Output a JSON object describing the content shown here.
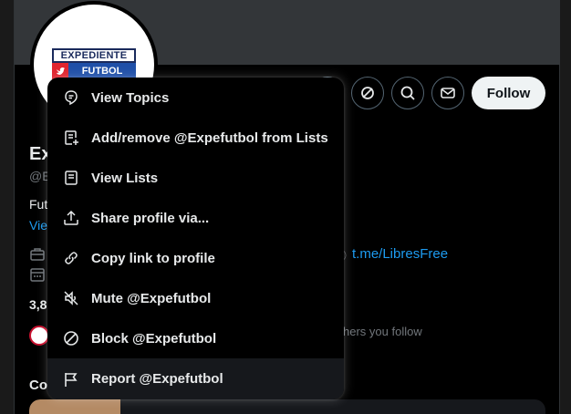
{
  "profile": {
    "logo_line1": "EXPEDIENTE",
    "logo_line2": "FUTBOL",
    "name_partial": "Ex",
    "handle_partial": "@E",
    "bio_partial": "Fut",
    "view_partial": "Vie",
    "link_text": "t.me/LibresFree",
    "stat_partial": "3,8",
    "followers_partial_text": "hers you follow",
    "section_partial": "Co",
    "follow_label": "Follow"
  },
  "actions": [
    {
      "icon": "unknown-partial-icon"
    },
    {
      "icon": "grok-icon"
    },
    {
      "icon": "search-icon"
    },
    {
      "icon": "message-icon"
    }
  ],
  "menu": {
    "items": [
      {
        "label": "View Topics",
        "icon": "topics-icon"
      },
      {
        "label": "Add/remove @Expefutbol from Lists",
        "icon": "list-add-icon"
      },
      {
        "label": "View Lists",
        "icon": "lists-icon"
      },
      {
        "label": "Share profile via...",
        "icon": "share-icon"
      },
      {
        "label": "Copy link to profile",
        "icon": "link-icon"
      },
      {
        "label": "Mute @Expefutbol",
        "icon": "mute-icon"
      },
      {
        "label": "Block @Expefutbol",
        "icon": "block-icon"
      },
      {
        "label": "Report @Expefutbol",
        "icon": "flag-icon"
      }
    ]
  },
  "colors": {
    "background": "#000000",
    "accent_link": "#1d9bf0",
    "text": "#e7e9ea",
    "muted": "#71767b",
    "menu_hover": "#16181c"
  }
}
